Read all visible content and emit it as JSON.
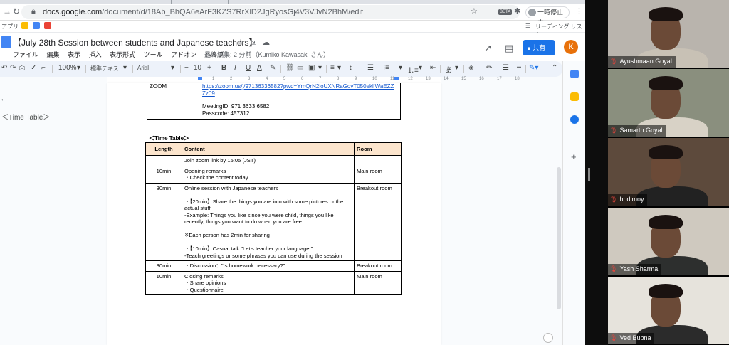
{
  "browser": {
    "url_host": "docs.google.com",
    "url_path": "/document/d/18Ab_BhQA6eArF3KZS7RrXlD2JgRyosGj4V3VJvN2BhM/edit",
    "pause_label": "一時停止中",
    "beta_label": "BETA",
    "bookmarks": {
      "apps": "アプリ",
      "reading_list": "リーディング リスト"
    }
  },
  "doc": {
    "title": "【July 28th Session between students and Japanese teachers】",
    "menu": [
      "ファイル",
      "編集",
      "表示",
      "挿入",
      "表示形式",
      "ツール",
      "アドオン",
      "ヘルプ"
    ],
    "last_edit": "最終編集: 2 分前（Kumiko Kawasaki さん）",
    "share_label": "共有",
    "avatar_letter": "K"
  },
  "toolbar": {
    "zoom": "100%",
    "style": "標準テキス...",
    "font": "Arial",
    "size": "10",
    "bold": "B",
    "italic": "I",
    "underline": "U",
    "text_color": "A",
    "kana": "あ"
  },
  "ruler": {
    "numbers": [
      "1",
      "2",
      "3",
      "4",
      "5",
      "6",
      "7",
      "8",
      "9",
      "10",
      "11",
      "12",
      "13",
      "14",
      "15",
      "16",
      "17",
      "18"
    ]
  },
  "outline": {
    "label": "＜Time Table＞"
  },
  "zoom_table": {
    "label": "ZOOM",
    "link": "https://zoom.us/j/97136336582?pwd=YmQrN2loUXNRaGovT050ekliWaEZZZz09",
    "meeting_id": "MeetingID: 971 3633 6582",
    "passcode": "Passcode: 457312"
  },
  "timetable": {
    "heading": "＜Time Table＞",
    "headers": {
      "length": "Length",
      "content": "Content",
      "room": "Room"
    },
    "rows": [
      {
        "length": "",
        "content": [
          "Join zoom link by 15:05 (JST)"
        ],
        "room": ""
      },
      {
        "length": "10min",
        "content": [
          "Opening remarks",
          "・Check the content today"
        ],
        "room": "Main room"
      },
      {
        "length": "30min",
        "content": [
          "Online session with Japanese teachers",
          "",
          "・【20min】Share the things you are into with some pictures or the actual stuff",
          "-Example: Things you like since you were child, things you like recently, things you want to do when you are free",
          "",
          "※Each person has 2min for sharing",
          "",
          "・【10min】Casual talk \"Let's teacher your language!\"",
          "-Teach greetings or some phrases you can use during the session"
        ],
        "room": "Breakout room"
      },
      {
        "length": "30min",
        "content": [
          "・Discussion：\"Is homework necessary?\""
        ],
        "room": "Breakout room"
      },
      {
        "length": "10min",
        "content": [
          "Closing remarks",
          "・Share opinions",
          "・Questionnaire"
        ],
        "room": "Main room"
      }
    ]
  },
  "participants": [
    {
      "name": "Ayushmaan Goyal",
      "bg": "#b9b4ad",
      "shirt": "#c8c1b5"
    },
    {
      "name": "Samarth Goyal",
      "bg": "#8a8f7e",
      "shirt": "#d8d2c6"
    },
    {
      "name": "hridimoy",
      "bg": "#5d4a3c",
      "shirt": "#222222"
    },
    {
      "name": "Yash Sharma",
      "bg": "#cfc9bf",
      "shirt": "#2d2f2e"
    },
    {
      "name": "Ved Bubna",
      "bg": "#e6e3dc",
      "shirt": "#2b2b2b"
    }
  ]
}
